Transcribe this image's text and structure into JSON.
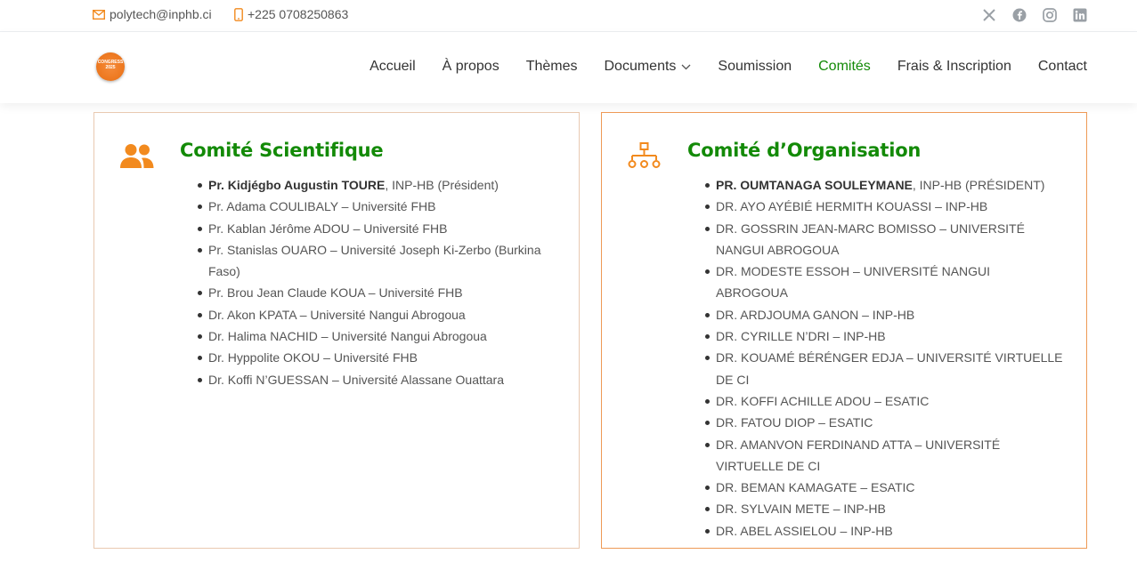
{
  "topbar": {
    "email": "polytech@inphb.ci",
    "phone": "+225 0708250863",
    "social": [
      "x-icon",
      "facebook-icon",
      "instagram-icon",
      "linkedin-icon"
    ]
  },
  "logo": {
    "text": "CONGRESS 2025"
  },
  "nav": {
    "items": [
      "Accueil",
      "À propos",
      "Thèmes",
      "Documents",
      "Soumission",
      "Comités",
      "Frais & Inscription",
      "Contact"
    ],
    "active": "Comités"
  },
  "colors": {
    "accent_green": "#138a07",
    "accent_orange": "#f28a1e"
  },
  "committees": {
    "scientific": {
      "title": "Comité Scientifique",
      "icon": "users-icon",
      "members": [
        {
          "strong": "Pr. Kidjégbo Augustin TOURE",
          "rest": ", INP-HB (Président)"
        },
        {
          "strong": "",
          "rest": "Pr. Adama COULIBALY – Université FHB"
        },
        {
          "strong": "",
          "rest": "Pr. Kablan Jérôme ADOU – Université FHB"
        },
        {
          "strong": "",
          "rest": "Pr. Stanislas OUARO – Université Joseph Ki-Zerbo (Burkina Faso)"
        },
        {
          "strong": "",
          "rest": "Pr. Brou Jean Claude KOUA – Université FHB"
        },
        {
          "strong": "",
          "rest": "Dr. Akon KPATA – Université Nangui Abrogoua"
        },
        {
          "strong": "",
          "rest": "Dr. Halima NACHID – Université Nangui Abrogoua"
        },
        {
          "strong": "",
          "rest": "Dr. Hyppolite OKOU – Université FHB"
        },
        {
          "strong": "",
          "rest": "Dr. Koffi N’GUESSAN – Université Alassane Ouattara"
        }
      ]
    },
    "organisation": {
      "title": "Comité d’Organisation",
      "icon": "org-chart-icon",
      "members": [
        {
          "strong": "Pr. Oumtanaga Souleymane",
          "rest": ", INP-HB (Président)"
        },
        {
          "strong": "",
          "rest": "Dr. Ayo Ayébié Hermith Kouassi – INP-HB"
        },
        {
          "strong": "",
          "rest": "Dr. Gossrin Jean-Marc Bomisso – Université Nangui Abrogoua"
        },
        {
          "strong": "",
          "rest": "Dr. Modeste Essoh – Université Nangui Abrogoua"
        },
        {
          "strong": "",
          "rest": "Dr. Ardjouma Ganon – INP-HB"
        },
        {
          "strong": "",
          "rest": "Dr. Cyrille N’Dri – INP-HB"
        },
        {
          "strong": "",
          "rest": "Dr. Kouamé Bérénger Edja – Université Virtuelle de CI"
        },
        {
          "strong": "",
          "rest": "Dr. Koffi Achille Adou – ESATIC"
        },
        {
          "strong": "",
          "rest": "Dr. Fatou Diop – ESATIC"
        },
        {
          "strong": "",
          "rest": "Dr. Amanvon Ferdinand Atta – Université Virtuelle de CI"
        },
        {
          "strong": "",
          "rest": "Dr. Beman Kamagate – ESATIC"
        },
        {
          "strong": "",
          "rest": "Dr. Sylvain Mete – INP-HB"
        },
        {
          "strong": "",
          "rest": "Dr. Abel Assielou – INP-HB"
        }
      ]
    }
  }
}
